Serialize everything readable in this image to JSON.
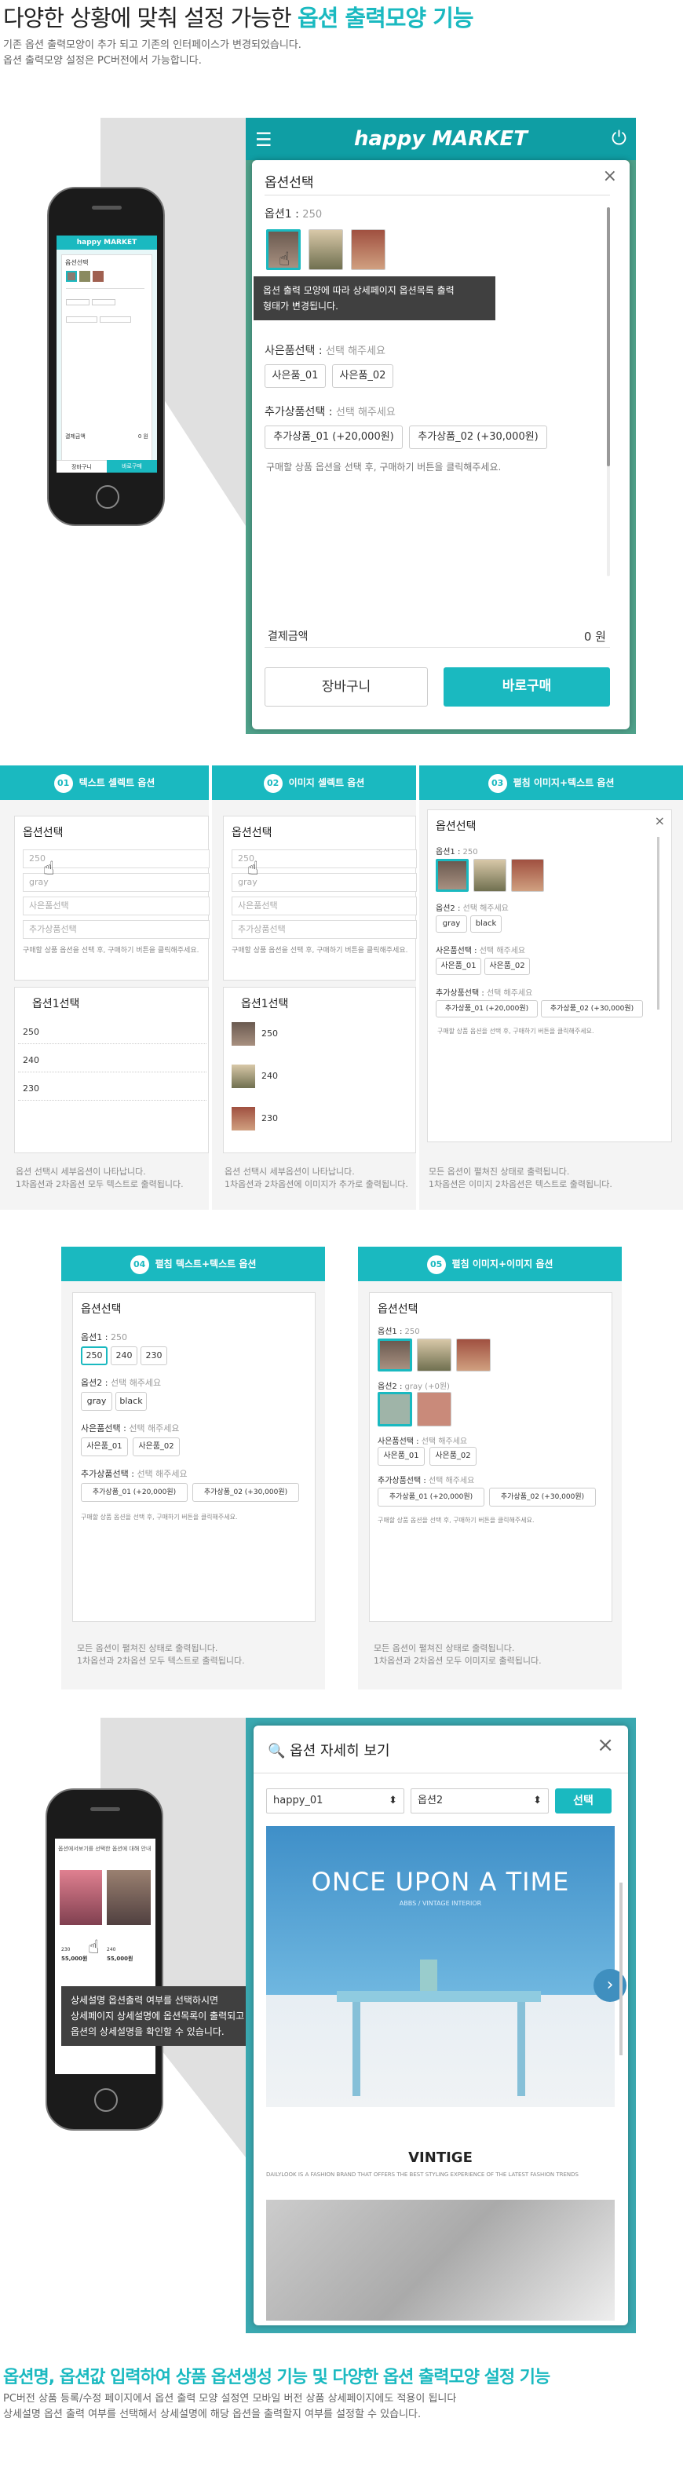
{
  "header": {
    "title_prefix": "다양한 상황에 맞춰 설정 가능한 ",
    "title_highlight": "옵션 출력모양 기능",
    "desc1": "기존 옵션 출력모양이 추가 되고 기존의 인터페이스가 변경되었습니다.",
    "desc2": "옵션 출력모양 설정은 PC버전에서 가능합니다."
  },
  "hero": {
    "brand": "happy MARKET",
    "modal_title": "옵션선택",
    "option1_label": "옵션1",
    "option1_value": "250",
    "tooltip1": "옵션 출력 모양에 따라 상세페이지 옵션목록 출력",
    "tooltip2": "형태가 변경됩니다.",
    "req_label": "사은품선택",
    "req_hint": "선택 해주세요",
    "req_items": [
      "사은품_01",
      "사은품_02"
    ],
    "add_label": "추가상품선택",
    "add_hint": "선택 해주세요",
    "add_items": [
      "추가상품_01 (+20,000원)",
      "추가상품_02 (+30,000원)"
    ],
    "guide": "구매할 상품 옵션을 선택 후, 구매하기 버튼을 클릭해주세요.",
    "total_label": "결제금액",
    "total_value": "0 원",
    "cart": "장바구니",
    "buy": "바로구매"
  },
  "phone1": {
    "brand": "happy MARKET",
    "title": "옵션선택",
    "label_amount": "결제금액",
    "amount": "0 원",
    "cart": "장바구니",
    "buy": "바로구매"
  },
  "cols": [
    {
      "num": "01",
      "title": "텍스트 셀렉트 옵션",
      "panel": "옵션선택",
      "rows": [
        "250",
        "gray",
        "사은품선택",
        "추가상품선택"
      ],
      "guide": "구매할 상품 옵션을 선택 후, 구매하기 버튼을 클릭해주세요.",
      "sub_title": "옵션1선택",
      "values": [
        "250",
        "240",
        "230"
      ],
      "note1": "옵션 선택시 세부옵션이 나타납니다.",
      "note2": "1차옵션과 2차옵션 모두 텍스트로 출력됩니다."
    },
    {
      "num": "02",
      "title": "이미지 셀렉트 옵션",
      "panel": "옵션선택",
      "rows": [
        "250",
        "gray",
        "사은품선택",
        "추가상품선택"
      ],
      "guide": "구매할 상품 옵션을 선택 후, 구매하기 버튼을 클릭해주세요.",
      "sub_title": "옵션1선택",
      "values": [
        "250",
        "240",
        "230"
      ],
      "note1": "옵션 선택시 세부옵션이 나타납니다.",
      "note2": "1차옵션과 2차옵션에 이미지가 추가로 출력됩니다."
    },
    {
      "num": "03",
      "title": "펼침 이미지+텍스트 옵션",
      "panel": "옵션선택",
      "opt1": "옵션1",
      "opt1v": "250",
      "opt2": "옵션2",
      "opt2v": "선택 해주세요",
      "colors": [
        "gray",
        "black"
      ],
      "req": "사은품선택",
      "reqv": "선택 해주세요",
      "reqs": [
        "사은품_01",
        "사은품_02"
      ],
      "add": "추가상품선택",
      "addv": "선택 해주세요",
      "adds": [
        "추가상품_01 (+20,000원)",
        "추가상품_02 (+30,000원)"
      ],
      "guide": "구매할 상품 옵션을 선택 후, 구매하기 버튼을 클릭해주세요.",
      "note1": "모든 옵션이 펼쳐진 상태로 출력됩니다.",
      "note2": "1차옵션은 이미지 2차옵션은 텍스트로 출력됩니다."
    }
  ],
  "cols2": [
    {
      "num": "04",
      "title": "펼침 텍스트+텍스트 옵션",
      "panel": "옵션선택",
      "opt1": "옵션1",
      "opt1v": "250",
      "sizes": [
        "250",
        "240",
        "230"
      ],
      "opt2": "옵션2",
      "opt2v": "선택 해주세요",
      "colors": [
        "gray",
        "black"
      ],
      "req": "사은품선택",
      "reqv": "선택 해주세요",
      "reqs": [
        "사은품_01",
        "사은품_02"
      ],
      "add": "추가상품선택",
      "addv": "선택 해주세요",
      "adds": [
        "추가상품_01 (+20,000원)",
        "추가상품_02 (+30,000원)"
      ],
      "guide": "구매할 상품 옵션을 선택 후, 구매하기 버튼을 클릭해주세요.",
      "note1": "모든 옵션이 펼쳐진 상태로 출력됩니다.",
      "note2": "1차옵션과 2차옵션 모두 텍스트로 출력됩니다."
    },
    {
      "num": "05",
      "title": "펼침 이미지+이미지 옵션",
      "panel": "옵션선택",
      "opt1": "옵션1",
      "opt1v": "250",
      "opt2": "옵션2",
      "opt2v": "gray (+0원)",
      "req": "사은품선택",
      "reqv": "선택 해주세요",
      "reqs": [
        "사은품_01",
        "사은품_02"
      ],
      "add": "추가상품선택",
      "addv": "선택 해주세요",
      "adds": [
        "추가상품_01 (+20,000원)",
        "추가상품_02 (+30,000원)"
      ],
      "guide": "구매할 상품 옵션을 선택 후, 구매하기 버튼을 클릭해주세요.",
      "note1": "모든 옵션이 펼쳐진 상태로 출력됩니다.",
      "note2": "1차옵션과 2차옵션 모두 이미지로 출력됩니다."
    }
  ],
  "detail": {
    "title": "옵션 자세히 보기",
    "select1": "happy_01",
    "select2": "옵션2",
    "select_btn": "선택",
    "banner_title": "ONCE UPON A TIME",
    "banner_sub": "ABBS / VINTAGE INTERIOR",
    "brand": "VINTIGE",
    "brand_desc": "DAILYLOOK IS A FASHION BRAND THAT OFFERS THE BEST STYLING EXPERIENCE OF THE LATEST FASHION TRENDS",
    "tooltip1": "상세설명 옵션출력 여부를 선택하시면",
    "tooltip2": "상세페이지 상세설명에 옵션목록이 출력되고 클릭시",
    "tooltip3": "옵션의 상세설명을 확인할 수 있습니다.",
    "phone_header": "옵션에서보기를 선택한 옵션에 대해 안내",
    "prices": [
      "55,000원",
      "55,000원"
    ],
    "sizes": [
      "230",
      "240"
    ]
  },
  "footer": {
    "title": "옵션명, 옵션값 입력하여 상품 옵션생성 기능 및 다양한 옵션 출력모양 설정 기능",
    "desc1": "PC버전 상품 등록/수정 페이지에서 옵션 출력 모양 설정연 모바일 버전 상품 상세페이지에도 적용이 됩니다",
    "desc2": "상세설명 옵션 출력 여부를 선택해서 상세설명에 해당 옵션을 출력할지 여부를 설정할 수 있습니다."
  }
}
